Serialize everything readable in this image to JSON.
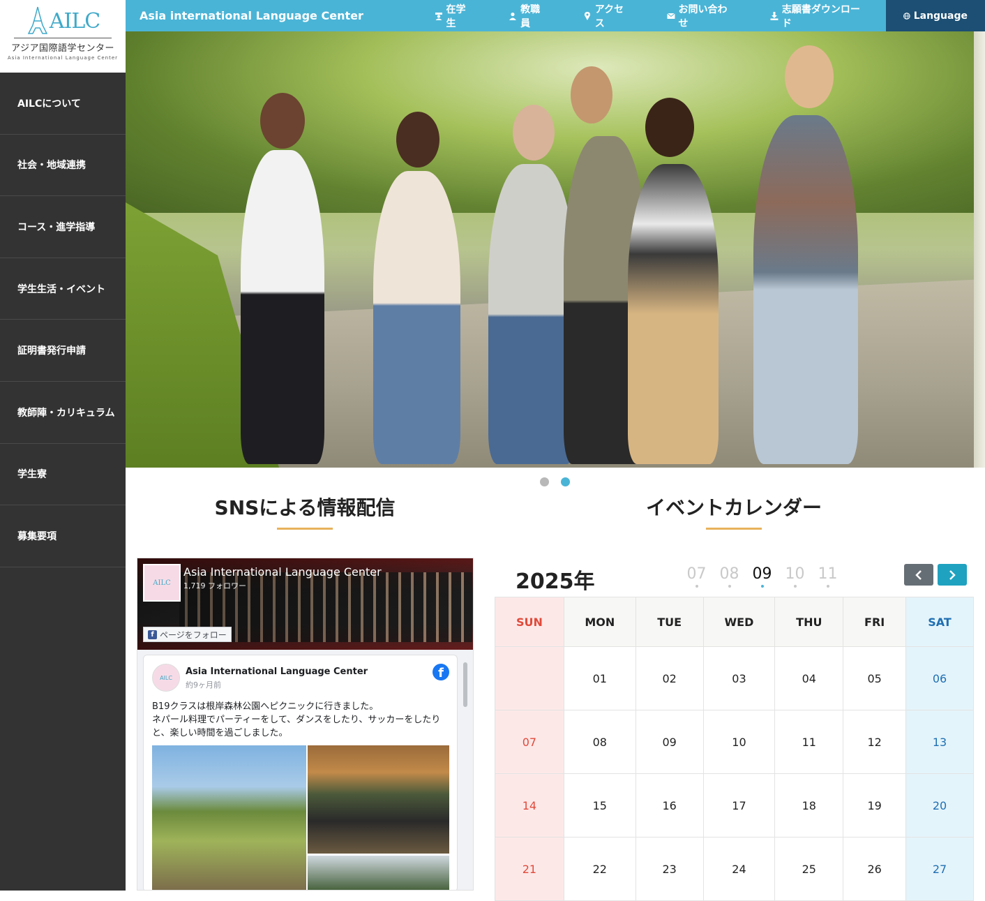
{
  "logo": {
    "mark": "AILC",
    "jp": "アジア国際語学センター",
    "en": "Asia International Language Center"
  },
  "sidebar": {
    "items": [
      {
        "label": "AILCについて"
      },
      {
        "label": "社会・地域連携"
      },
      {
        "label": "コース・進学指導"
      },
      {
        "label": "学生生活・イベント"
      },
      {
        "label": "証明書発行申請"
      },
      {
        "label": "教師陣・カリキュラム"
      },
      {
        "label": "学生寮"
      },
      {
        "label": "募集要項"
      }
    ]
  },
  "topbar": {
    "title": "Asia international Language Center",
    "links": [
      {
        "label": "在学生",
        "icon": "student-icon"
      },
      {
        "label": "教職員",
        "icon": "staff-icon"
      },
      {
        "label": "アクセス",
        "icon": "map-pin-icon"
      },
      {
        "label": "お問い合わせ",
        "icon": "envelope-icon"
      },
      {
        "label": "志願書ダウンロード",
        "icon": "download-icon"
      }
    ],
    "language": {
      "label": "Language",
      "icon": "globe-icon"
    }
  },
  "sections": {
    "sns": "SNSによる情報配信",
    "calendar": "イベントカレンダー"
  },
  "facebook": {
    "page_name": "Asia International Language Center",
    "followers": "1,719 フォロワー",
    "follow_label": "ページをフォロー",
    "post": {
      "author": "Asia International Language Center",
      "time": "約9ヶ月前",
      "text": "B19クラスは根岸森林公園へピクニックに行きました。\nネパール料理でパーティーをして、ダンスをしたり、サッカーをしたりと、楽しい時間を過ごしました。"
    }
  },
  "calendar": {
    "year": "2025年",
    "months": [
      "07",
      "08",
      "09",
      "10",
      "11"
    ],
    "current_month": "09",
    "weekdays": [
      "SUN",
      "MON",
      "TUE",
      "WED",
      "THU",
      "FRI",
      "SAT"
    ],
    "weeks": [
      [
        "",
        "01",
        "02",
        "03",
        "04",
        "05",
        "06"
      ],
      [
        "07",
        "08",
        "09",
        "10",
        "11",
        "12",
        "13"
      ],
      [
        "14",
        "15",
        "16",
        "17",
        "18",
        "19",
        "20"
      ],
      [
        "21",
        "22",
        "23",
        "24",
        "25",
        "26",
        "27"
      ]
    ]
  },
  "colors": {
    "accent": "#4ab4d6",
    "sidebar": "#333333",
    "underline": "#e8b25a",
    "sunday": "#e04a3a",
    "saturday": "#1f6fb2"
  }
}
